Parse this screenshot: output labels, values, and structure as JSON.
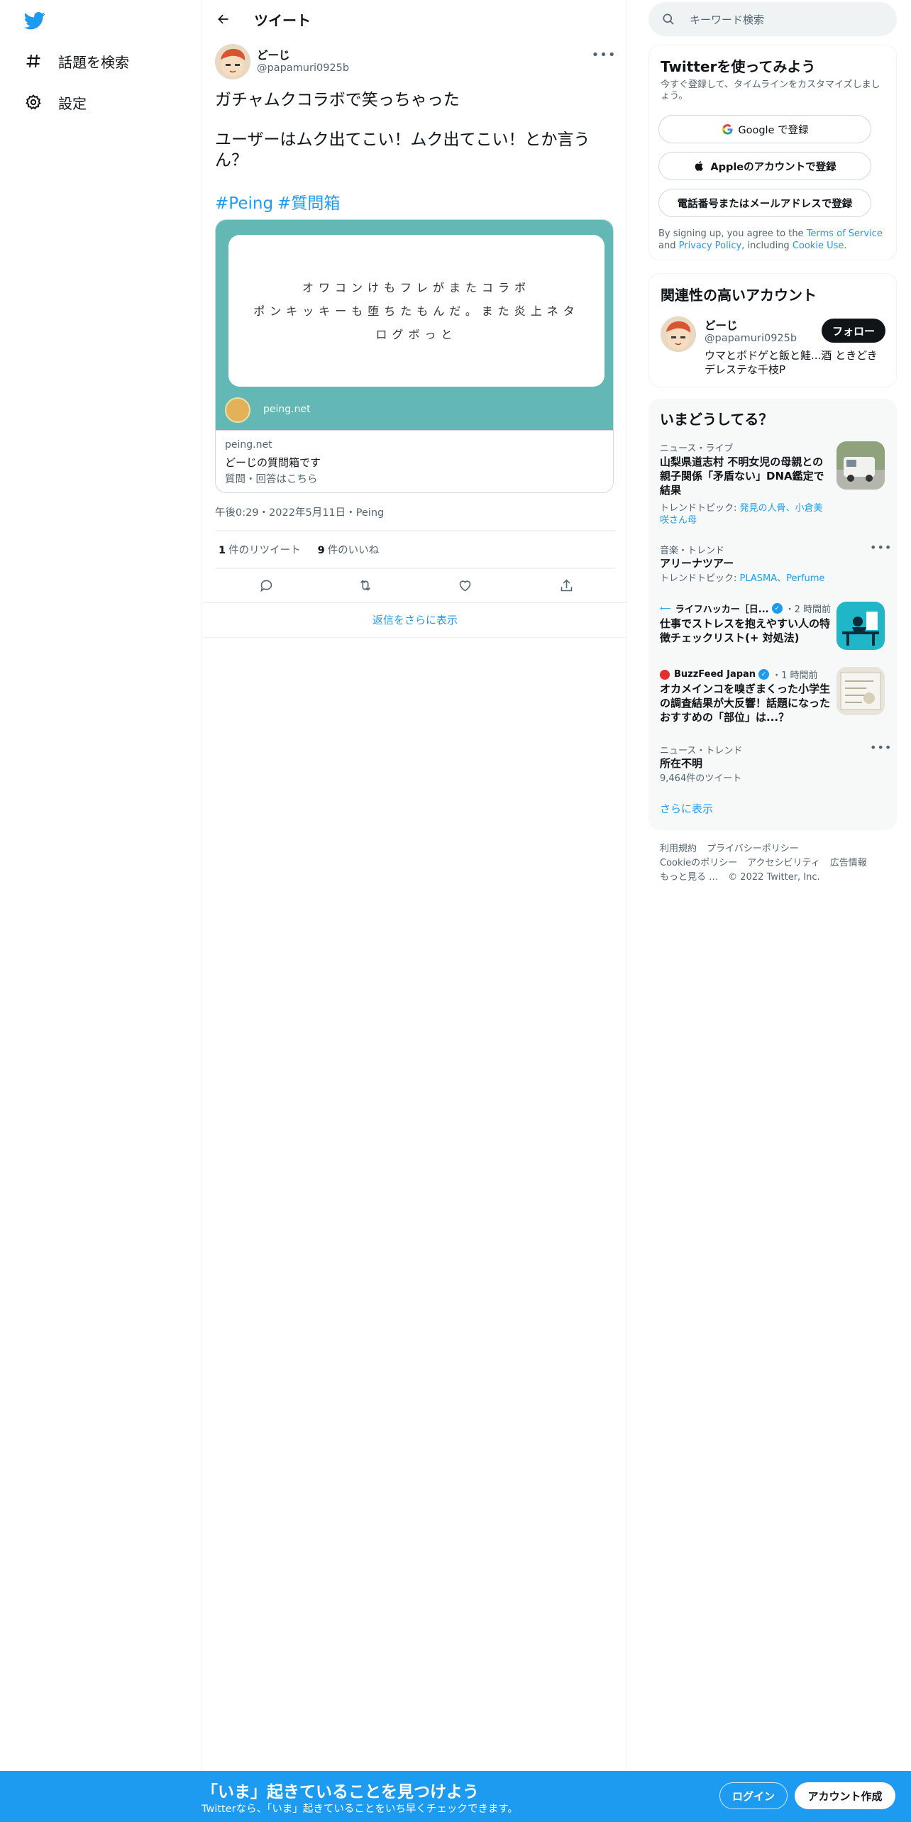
{
  "nav": {
    "items": [
      {
        "label": "話題を検索",
        "icon": "hashtag-icon"
      },
      {
        "label": "設定",
        "icon": "gear-icon"
      }
    ]
  },
  "header": {
    "title": "ツイート"
  },
  "tweet": {
    "author_name": "どーじ",
    "author_handle": "@papamuri0925b",
    "text_line1": "ガチャムクコラボで笑っちゃった",
    "text_line2": "ユーザーはムク出てこい！ムク出てこい！とか言うん？",
    "hashtags": [
      "#Peing",
      "#質問箱"
    ],
    "card": {
      "image_lines": [
        "オワコンけもフレがまたコラボ",
        "ポンキッキーも堕ちたもんだ。また炎上ネタログボっと"
      ],
      "image_domain": "peing.net",
      "domain": "peing.net",
      "title": "どーじの質問箱です",
      "description": "質問・回答はこちら"
    },
    "meta": "午後0:29・2022年5月11日・Peing",
    "retweets_count": "1",
    "retweets_label": "件のリツイート",
    "likes_count": "9",
    "likes_label": "件のいいね",
    "show_more_replies": "返信をさらに表示"
  },
  "search": {
    "placeholder": "キーワード検索"
  },
  "signup": {
    "title": "Twitterを使ってみよう",
    "description": "今すぐ登録して、タイムラインをカスタマイズしましょう。",
    "google_button": "Google で登録",
    "apple_button": "Appleのアカウントで登録",
    "phone_button": "電話番号またはメールアドレスで登録",
    "legal_prefix": "By signing up, you agree to the",
    "terms_link": "Terms of Service",
    "legal_and": "and",
    "privacy_link": "Privacy Policy",
    "legal_including": ", including",
    "cookie_link": "Cookie Use",
    "legal_end": "."
  },
  "related": {
    "title": "関連性の高いアカウント",
    "name": "どーじ",
    "handle": "@papamuri0925b",
    "bio": "ウマとボドゲと飯と鮭...酒 ときどきデレステな千枝P",
    "follow_button": "フォロー"
  },
  "trends": {
    "title": "いまどうしてる？",
    "items": [
      {
        "category": "ニュース・ライブ",
        "title": "山梨県道志村 不明女児の母親との親子関係「矛盾ない」DNA鑑定で結果",
        "sub_prefix": "トレンドトピック:",
        "sub_links": "発見の人骨、小倉美咲さん母"
      },
      {
        "category": "音楽・トレンド",
        "title": "アリーナツアー",
        "sub_prefix": "トレンドトピック:",
        "sub_links": "PLASMA、Perfume"
      },
      {
        "source": "ライフハッカー［日...",
        "time": "・2 時間前",
        "title": "仕事でストレスを抱えやすい人の特徴チェックリスト(+ 対処法)"
      },
      {
        "source": "BuzzFeed Japan",
        "time": "・1 時間前",
        "title": "オカメインコを嗅ぎまくった小学生の調査結果が大反響！話題になったおすすめの「部位」は...？"
      },
      {
        "category": "ニュース・トレンド",
        "title": "所在不明",
        "sub": "9,464件のツイート"
      }
    ],
    "show_more": "さらに表示"
  },
  "footer": {
    "links": [
      "利用規約",
      "プライバシーポリシー",
      "Cookieのポリシー",
      "アクセシビリティ",
      "広告情報",
      "もっと見る …",
      "© 2022 Twitter, Inc."
    ]
  },
  "bottom_bar": {
    "title": "「いま」起きていることを見つけよう",
    "subtitle": "Twitterなら、「いま」起きていることをいち早くチェックできます。",
    "login_button": "ログイン",
    "signup_button": "アカウント作成"
  },
  "colors": {
    "accent": "#1d9bf0",
    "card_teal": "#63b8b6",
    "text": "#0f1419",
    "muted": "#536471"
  }
}
